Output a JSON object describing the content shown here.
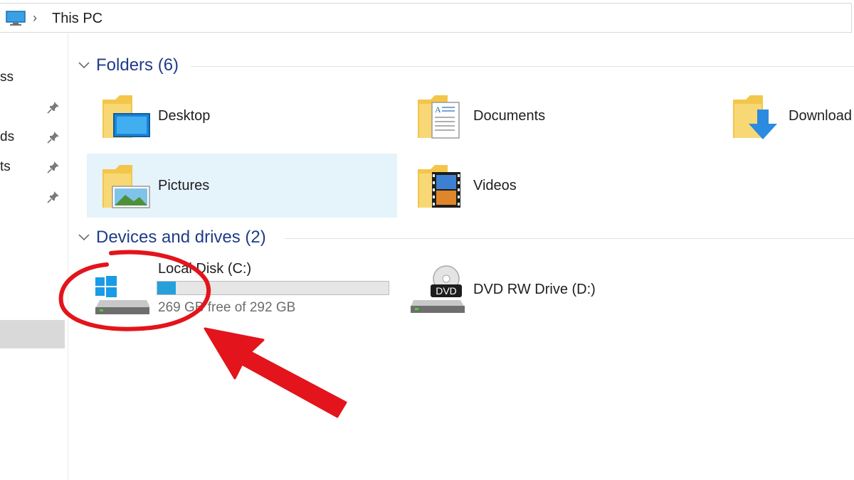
{
  "address_bar": {
    "breadcrumb": "This PC"
  },
  "nav": {
    "items": [
      {
        "label": "ss",
        "pinned": false
      },
      {
        "label": "",
        "pinned": true
      },
      {
        "label": "ds",
        "pinned": true
      },
      {
        "label": "ts",
        "pinned": true
      },
      {
        "label": "",
        "pinned": true
      }
    ]
  },
  "folders": {
    "title": "Folders (6)",
    "items": [
      {
        "label": "Desktop",
        "icon": "desktop-folder-icon"
      },
      {
        "label": "Documents",
        "icon": "documents-folder-icon"
      },
      {
        "label": "Download",
        "icon": "downloads-folder-icon"
      },
      {
        "label": "Pictures",
        "icon": "pictures-folder-icon",
        "selected": true
      },
      {
        "label": "Videos",
        "icon": "videos-folder-icon"
      }
    ]
  },
  "devices": {
    "title": "Devices and drives (2)",
    "items": [
      {
        "label": "Local Disk (C:)",
        "free_text": "269 GB free of 292 GB",
        "used_fraction": 0.079,
        "icon": "windows-drive-icon"
      },
      {
        "label": "DVD RW Drive (D:)",
        "icon": "dvd-drive-icon",
        "badge": "DVD"
      }
    ]
  },
  "colors": {
    "group_title": "#1f3c88",
    "selection": "#e5f3fb",
    "usage_fill": "#26a0da",
    "annotation": "#e3141b"
  }
}
